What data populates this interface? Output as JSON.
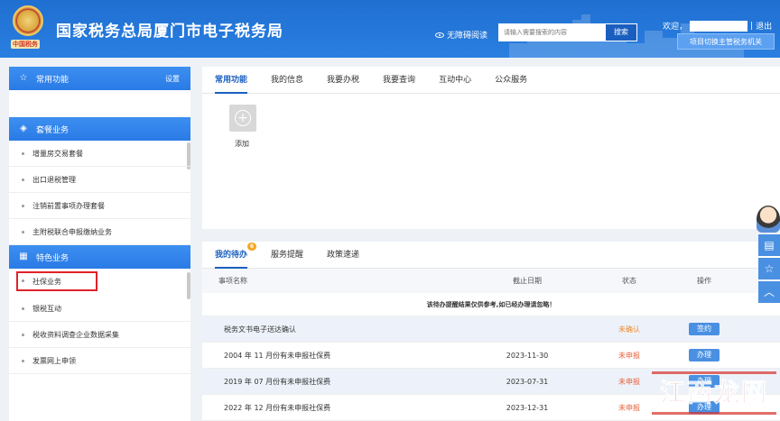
{
  "header": {
    "emblem_caption": "中国税务",
    "title": "国家税务总局厦门市电子税务局",
    "accessibility": "无障碍阅读",
    "search_placeholder": "请输入需要搜索的内容",
    "search_button": "搜索",
    "welcome": "欢迎，",
    "logout": "退出",
    "switch_authority": "项目切换主管税务机关"
  },
  "sidebar": {
    "common": {
      "title": "常用功能",
      "setting": "设置"
    },
    "package": {
      "title": "套餐业务",
      "items": [
        "增量房交易套餐",
        "出口退税管理",
        "注销前置事项办理套餐",
        "主附税联合申报缴纳业务"
      ]
    },
    "special": {
      "title": "特色业务",
      "items": [
        "社保业务",
        "银税互动",
        "税收资料调查企业数据采集",
        "发票网上申领"
      ]
    }
  },
  "top_panel": {
    "tabs": [
      "常用功能",
      "我的信息",
      "我要办税",
      "我要查询",
      "互动中心",
      "公众服务"
    ],
    "add_label": "添加"
  },
  "todo_panel": {
    "tabs": [
      "我的待办",
      "服务提醒",
      "政策速递"
    ],
    "badge": "6",
    "columns": [
      "事项名称",
      "截止日期",
      "状态",
      "操作"
    ],
    "notice": "该待办提醒结果仅供参考,如已经办理请忽略！",
    "rows": [
      {
        "name": "税务文书电子送达确认",
        "deadline": "",
        "status": "未确认",
        "action": "签约"
      },
      {
        "name": "2004 年 11 月份有未申报社保费",
        "deadline": "2023-11-30",
        "status": "未申报",
        "action": "办理"
      },
      {
        "name": "2019 年 07 月份有未申报社保费",
        "deadline": "2023-07-31",
        "status": "未申报",
        "action": "办理"
      },
      {
        "name": "2022 年 12 月份有未申报社保费",
        "deadline": "2023-12-31",
        "status": "未申报",
        "action": "办理"
      }
    ]
  },
  "watermark": "江西龙网"
}
